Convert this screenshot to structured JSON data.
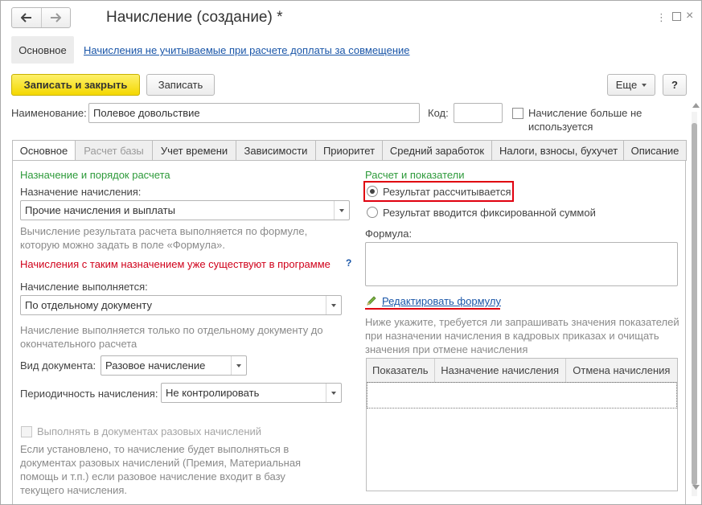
{
  "window": {
    "title": "Начисление (создание) *"
  },
  "topnav": {
    "main_label": "Основное",
    "link_label": "Начисления не учитываемые при расчете доплаты за совмещение"
  },
  "toolbar": {
    "save_close_label": "Записать и закрыть",
    "save_label": "Записать",
    "more_label": "Еще",
    "help_label": "?"
  },
  "header": {
    "name_label": "Наименование:",
    "name_value": "Полевое довольствие",
    "code_label": "Код:",
    "code_value": "",
    "unused_label": "Начисление больше не используется",
    "unused_checked": false
  },
  "tabs": [
    {
      "label": "Основное",
      "active": true,
      "disabled": false
    },
    {
      "label": "Расчет базы",
      "active": false,
      "disabled": true
    },
    {
      "label": "Учет времени",
      "active": false,
      "disabled": false
    },
    {
      "label": "Зависимости",
      "active": false,
      "disabled": false
    },
    {
      "label": "Приоритет",
      "active": false,
      "disabled": false
    },
    {
      "label": "Средний заработок",
      "active": false,
      "disabled": false
    },
    {
      "label": "Налоги, взносы, бухучет",
      "active": false,
      "disabled": false
    },
    {
      "label": "Описание",
      "active": false,
      "disabled": false
    }
  ],
  "left": {
    "section_title": "Назначение и порядок расчета",
    "purpose_label": "Назначение начисления:",
    "purpose_value": "Прочие начисления и выплаты",
    "purpose_hint": "Вычисление результата расчета выполняется по формуле, которую можно задать в поле «Формула».",
    "warning": "Начисления с таким назначением уже существуют в программе",
    "warning_help": "?",
    "execution_label": "Начисление выполняется:",
    "execution_value": "По отдельному документу",
    "execution_hint": "Начисление выполняется только по отдельному документу до окончательного расчета",
    "doc_type_label": "Вид документа:",
    "doc_type_value": "Разовое начисление",
    "periodicity_label": "Периодичность начисления:",
    "periodicity_value": "Не контролировать",
    "onetime_checkbox_label": "Выполнять в документах разовых начислений",
    "onetime_checked": false,
    "onetime_hint": "Если установлено, то начисление будет выполняться в документах разовых начислений (Премия, Материальная помощь и т.п.) если разовое начисление входит в базу текущего начисления."
  },
  "right": {
    "section_title": "Расчет и показатели",
    "radio_calculated": "Результат рассчитывается",
    "radio_fixed": "Результат вводится фиксированной суммой",
    "selected_radio": "calculated",
    "formula_label": "Формула:",
    "formula_value": "",
    "edit_formula_link": "Редактировать формулу",
    "indicators_hint": "Ниже укажите, требуется ли запрашивать значения показателей при назначении начисления в кадровых приказах и очищать значения при отмене начисления",
    "table_columns": [
      "Показатель",
      "Назначение начисления",
      "Отмена начисления"
    ],
    "table_rows": []
  },
  "colors": {
    "accent_yellow": "#f4d800",
    "section_green": "#2d9a3a",
    "warning_red": "#d0021b",
    "link_blue": "#1a56a8",
    "highlight_red": "#e0000f"
  },
  "icons": {
    "back": "arrow-left-icon",
    "forward": "arrow-right-icon",
    "menu": "more-vertical-icon",
    "maximize": "maximize-icon",
    "close": "close-icon",
    "pencil": "pencil-icon"
  }
}
